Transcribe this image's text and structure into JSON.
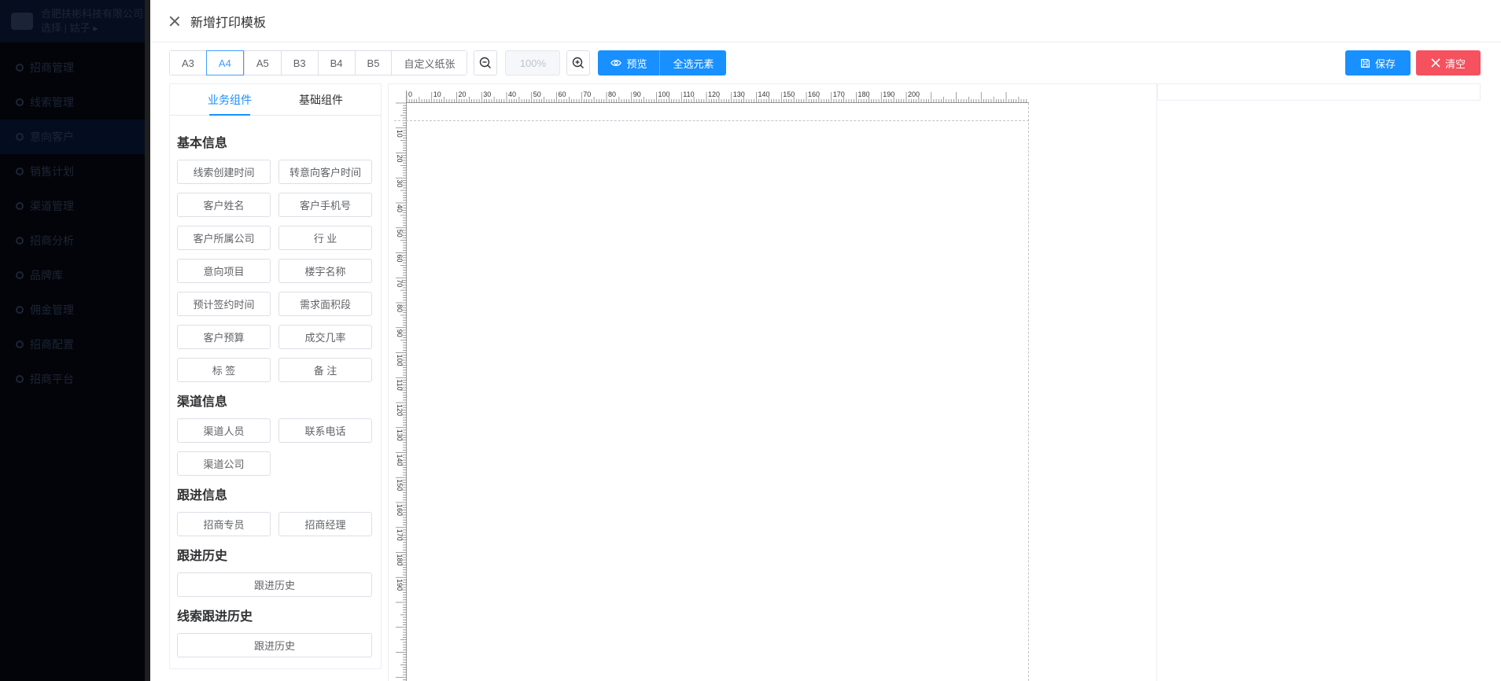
{
  "background_app": {
    "company": "合肥扶彬科技有限公司",
    "user": "选择 | 姑子 ▸",
    "menu": [
      {
        "label": "招商管理",
        "active": false
      },
      {
        "label": "线索管理",
        "active": false
      },
      {
        "label": "意向客户",
        "active": true
      },
      {
        "label": "销售计划",
        "active": false
      },
      {
        "label": "渠道管理",
        "active": false
      },
      {
        "label": "招商分析",
        "active": false
      },
      {
        "label": "品牌库",
        "active": false
      },
      {
        "label": "佣金管理",
        "active": false
      },
      {
        "label": "招商配置",
        "active": false
      },
      {
        "label": "招商平台",
        "active": false
      }
    ]
  },
  "drawer": {
    "title": "新增打印模板",
    "close_icon": "close-icon"
  },
  "toolbar": {
    "paper_sizes": [
      "A3",
      "A4",
      "A5",
      "B3",
      "B4",
      "B5",
      "自定义纸张"
    ],
    "active_paper": "A4",
    "zoom_out_icon": "zoom-out-icon",
    "zoom_value": "100%",
    "zoom_in_icon": "zoom-in-icon",
    "preview_label": "预览",
    "select_all_label": "全选元素",
    "save_label": "保存",
    "clear_label": "清空"
  },
  "left_panel": {
    "tabs": [
      "业务组件",
      "基础组件"
    ],
    "active_tab": "业务组件",
    "sections": [
      {
        "title": "基本信息",
        "items": [
          "线索创建时间",
          "转意向客户时间",
          "客户姓名",
          "客户手机号",
          "客户所属公司",
          "行 业",
          "意向项目",
          "楼宇名称",
          "预计签约时间",
          "需求面积段",
          "客户预算",
          "成交几率",
          "标 签",
          "备 注"
        ]
      },
      {
        "title": "渠道信息",
        "items": [
          "渠道人员",
          "联系电话",
          "渠道公司"
        ]
      },
      {
        "title": "跟进信息",
        "items": [
          "招商专员",
          "招商经理"
        ]
      },
      {
        "title": "跟进历史",
        "items": [
          "跟进历史"
        ],
        "wide": true
      },
      {
        "title": "线索跟进历史",
        "items": [
          "跟进历史"
        ],
        "wide": true
      }
    ]
  },
  "ruler": {
    "top_labels": [
      "0",
      "10",
      "20",
      "30",
      "40",
      "50",
      "60",
      "70",
      "80",
      "90",
      "100",
      "110",
      "120",
      "130",
      "140",
      "150",
      "160",
      "170",
      "180",
      "190",
      "200"
    ],
    "left_labels": [
      "10",
      "20",
      "30",
      "40",
      "50",
      "60",
      "70",
      "80",
      "90",
      "100",
      "110",
      "120",
      "130",
      "140",
      "150",
      "160",
      "170",
      "180",
      "190"
    ]
  }
}
